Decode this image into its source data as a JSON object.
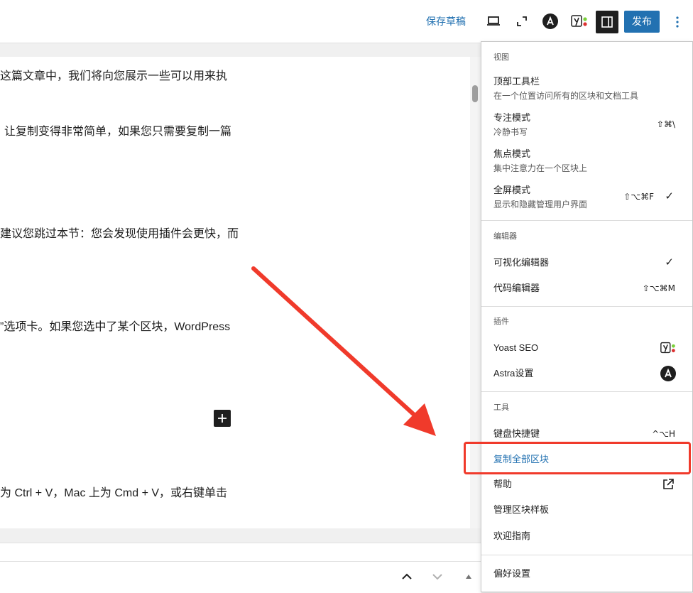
{
  "toolbar": {
    "save_draft": "保存草稿",
    "publish": "发布"
  },
  "content": {
    "paragraphs": [
      "这篇文章中，我们将向您展示一些可以用来执",
      "让复制变得非常简单，如果您只需要复制一篇",
      "建议您跳过本节：您会发现使用插件会更快，而",
      "”选项卡。如果您选中了某个区块，WordPress",
      "为 Ctrl + V，Mac 上为 Cmd + V，或右键单击"
    ]
  },
  "menu": {
    "view": {
      "title": "视图",
      "top_toolbar": "顶部工具栏",
      "top_toolbar_desc": "在一个位置访问所有的区块和文档工具",
      "distraction_free": "专注模式",
      "distraction_free_desc": "冷静书写",
      "distraction_free_shortcut": "⇧⌘\\",
      "spotlight": "焦点模式",
      "spotlight_desc": "集中注意力在一个区块上",
      "fullscreen": "全屏模式",
      "fullscreen_desc": "显示和隐藏管理用户界面",
      "fullscreen_shortcut": "⇧⌥⌘F",
      "check": "✓"
    },
    "editor": {
      "title": "编辑器",
      "visual": "可视化编辑器",
      "code": "代码编辑器",
      "code_shortcut": "⇧⌥⌘M",
      "check": "✓"
    },
    "plugins": {
      "title": "插件",
      "yoast": "Yoast SEO",
      "astra": "Astra设置"
    },
    "tools": {
      "title": "工具",
      "shortcuts": "键盘快捷键",
      "shortcuts_key": "^⌥H",
      "copy_all": "复制全部区块",
      "help": "帮助",
      "manage_patterns": "管理区块样板",
      "welcome": "欢迎指南"
    },
    "preferences": "偏好设置"
  },
  "colors": {
    "accent": "#2271b1",
    "highlight": "#f03a2b"
  }
}
